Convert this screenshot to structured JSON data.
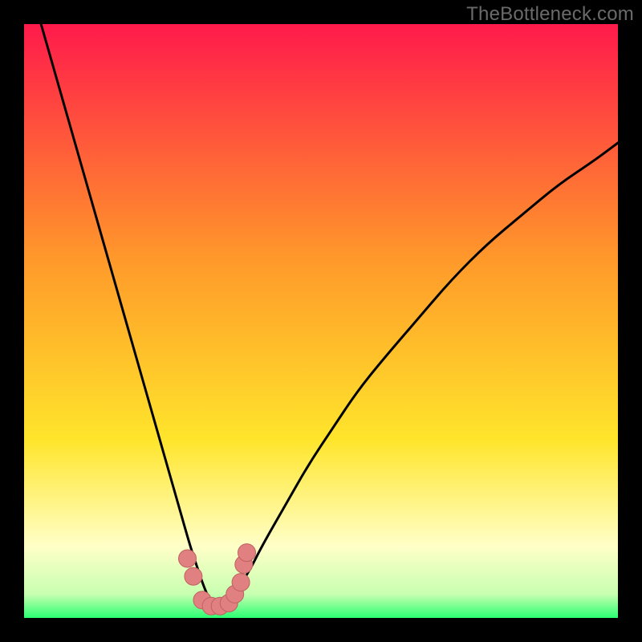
{
  "watermark": "TheBottleneck.com",
  "colors": {
    "frame": "#000000",
    "gradient_top": "#ff1a4b",
    "gradient_mid1": "#ff7a2a",
    "gradient_mid2": "#ffe52b",
    "gradient_pale": "#ffffc8",
    "gradient_green": "#2bff73",
    "curve": "#000000",
    "marker_fill": "#e08080",
    "marker_stroke": "#c06060"
  },
  "chart_data": {
    "type": "line",
    "title": "",
    "xlabel": "",
    "ylabel": "",
    "xlim": [
      0,
      100
    ],
    "ylim": [
      0,
      100
    ],
    "grid": false,
    "legend": false,
    "curve": {
      "description": "V-shaped bottleneck curve: steep descending branch from upper-left to a valley near x≈32, then a gently rising branch toward the right edge",
      "x": [
        0,
        2,
        4,
        6,
        8,
        10,
        12,
        14,
        16,
        18,
        20,
        22,
        24,
        26,
        28,
        29,
        30,
        31,
        32,
        33,
        34,
        35,
        36,
        38,
        40,
        44,
        48,
        52,
        56,
        60,
        66,
        72,
        78,
        84,
        90,
        96,
        100
      ],
      "y": [
        110,
        103,
        96,
        89,
        82,
        75,
        68,
        61,
        54,
        47,
        40,
        33,
        26,
        19,
        12,
        9,
        6,
        3.5,
        2,
        2,
        2.5,
        3.5,
        5,
        8,
        12,
        19,
        26,
        32,
        38,
        43,
        50,
        57,
        63,
        68,
        73,
        77,
        80
      ]
    },
    "markers": {
      "description": "Short cluster of salmon/pink dots along the valley floor",
      "points": [
        {
          "x": 27.5,
          "y": 10
        },
        {
          "x": 28.5,
          "y": 7
        },
        {
          "x": 30.0,
          "y": 3
        },
        {
          "x": 31.5,
          "y": 2
        },
        {
          "x": 33.0,
          "y": 2
        },
        {
          "x": 34.5,
          "y": 2.5
        },
        {
          "x": 35.5,
          "y": 4
        },
        {
          "x": 36.5,
          "y": 6
        },
        {
          "x": 37.0,
          "y": 9
        },
        {
          "x": 37.5,
          "y": 11
        }
      ],
      "radius_px": 11
    }
  }
}
